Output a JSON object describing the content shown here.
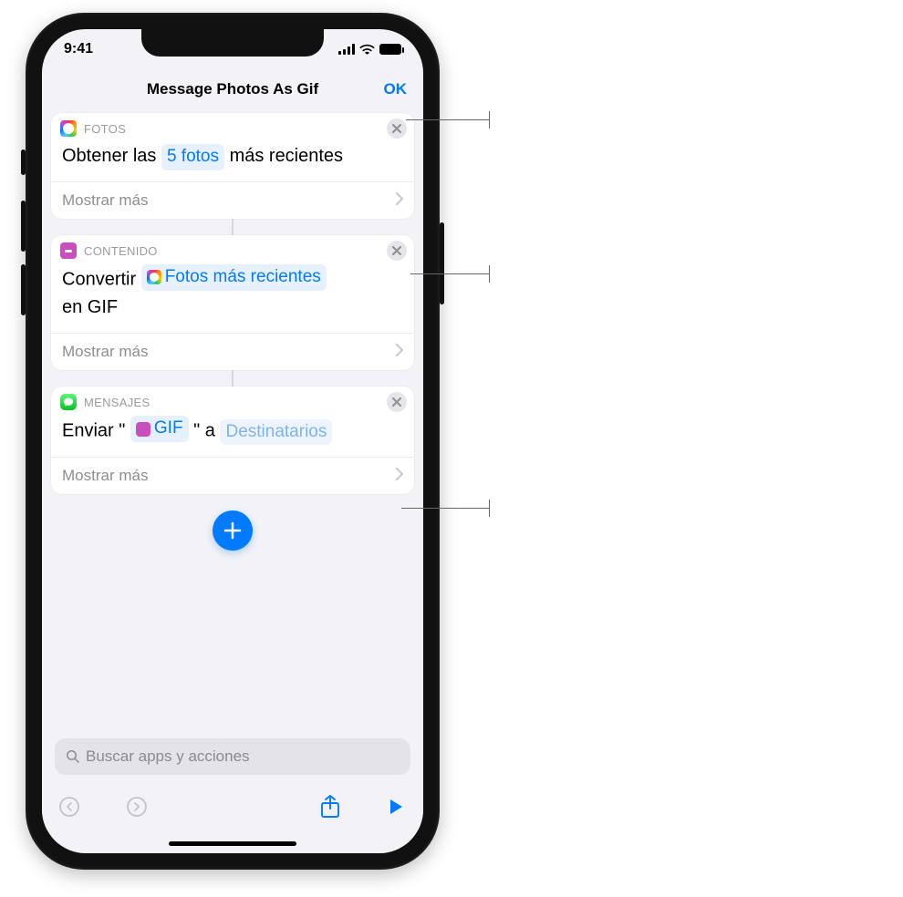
{
  "statusbar": {
    "time": "9:41"
  },
  "navbar": {
    "title": "Message Photos As Gif",
    "ok": "OK"
  },
  "actions": {
    "a1": {
      "category": "FOTOS",
      "pre": "Obtener las ",
      "token": "5 fotos",
      "post": " más recientes",
      "showMore": "Mostrar más"
    },
    "a2": {
      "category": "CONTENIDO",
      "pre": "Convertir ",
      "token": "Fotos más recientes",
      "post_line2": "en GIF",
      "showMore": "Mostrar más"
    },
    "a3": {
      "category": "MENSAJES",
      "pre": "Enviar \" ",
      "token": "GIF",
      "mid": " \" a ",
      "token2": "Destinatarios",
      "showMore": "Mostrar más"
    }
  },
  "search": {
    "placeholder": "Buscar apps y acciones"
  }
}
